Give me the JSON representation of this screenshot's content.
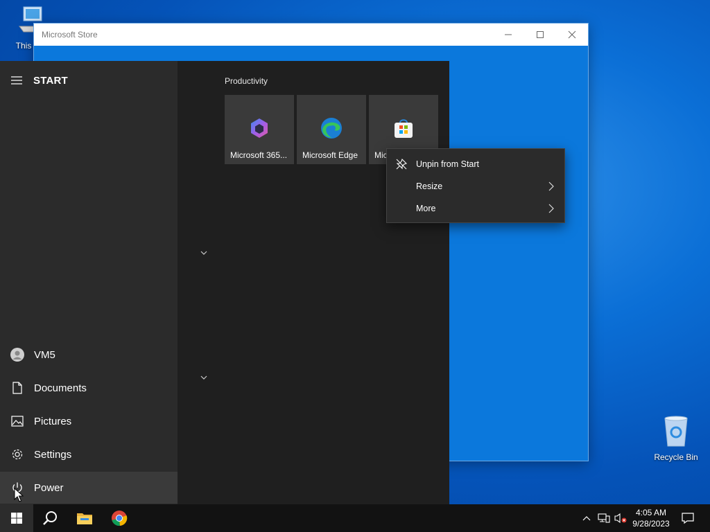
{
  "desktop": {
    "icons": [
      {
        "label": "This PC"
      },
      {
        "label": "Recycle Bin"
      }
    ]
  },
  "store_window": {
    "title": "Microsoft Store",
    "controls": {
      "minimize": "minimize-icon",
      "maximize": "maximize-icon",
      "close": "close-icon"
    }
  },
  "start_menu": {
    "header": "START",
    "left_items": [
      {
        "label": "VM5",
        "icon": "user-avatar-icon"
      },
      {
        "label": "Documents",
        "icon": "document-icon"
      },
      {
        "label": "Pictures",
        "icon": "pictures-icon"
      },
      {
        "label": "Settings",
        "icon": "gear-icon"
      },
      {
        "label": "Power",
        "icon": "power-icon"
      }
    ],
    "group": {
      "title": "Productivity",
      "tiles": [
        {
          "label": "Microsoft 365...",
          "icon": "microsoft-365-icon"
        },
        {
          "label": "Microsoft Edge",
          "icon": "edge-icon"
        },
        {
          "label": "Mic",
          "icon": "store-icon"
        }
      ]
    }
  },
  "context_menu": {
    "items": [
      {
        "label": "Unpin from Start",
        "icon": "unpin-icon"
      },
      {
        "label": "Resize",
        "has_submenu": true
      },
      {
        "label": "More",
        "has_submenu": true
      }
    ]
  },
  "taskbar": {
    "apps": [
      "start-icon",
      "search-icon",
      "file-explorer-icon",
      "chrome-icon"
    ],
    "clock": {
      "time": "4:05 AM",
      "date": "9/28/2023"
    }
  },
  "colors": {
    "accent": "#0b78dc",
    "start_bg": "#1f1f1f",
    "start_left_bg": "#2b2b2b",
    "taskbar_bg": "#121212"
  }
}
